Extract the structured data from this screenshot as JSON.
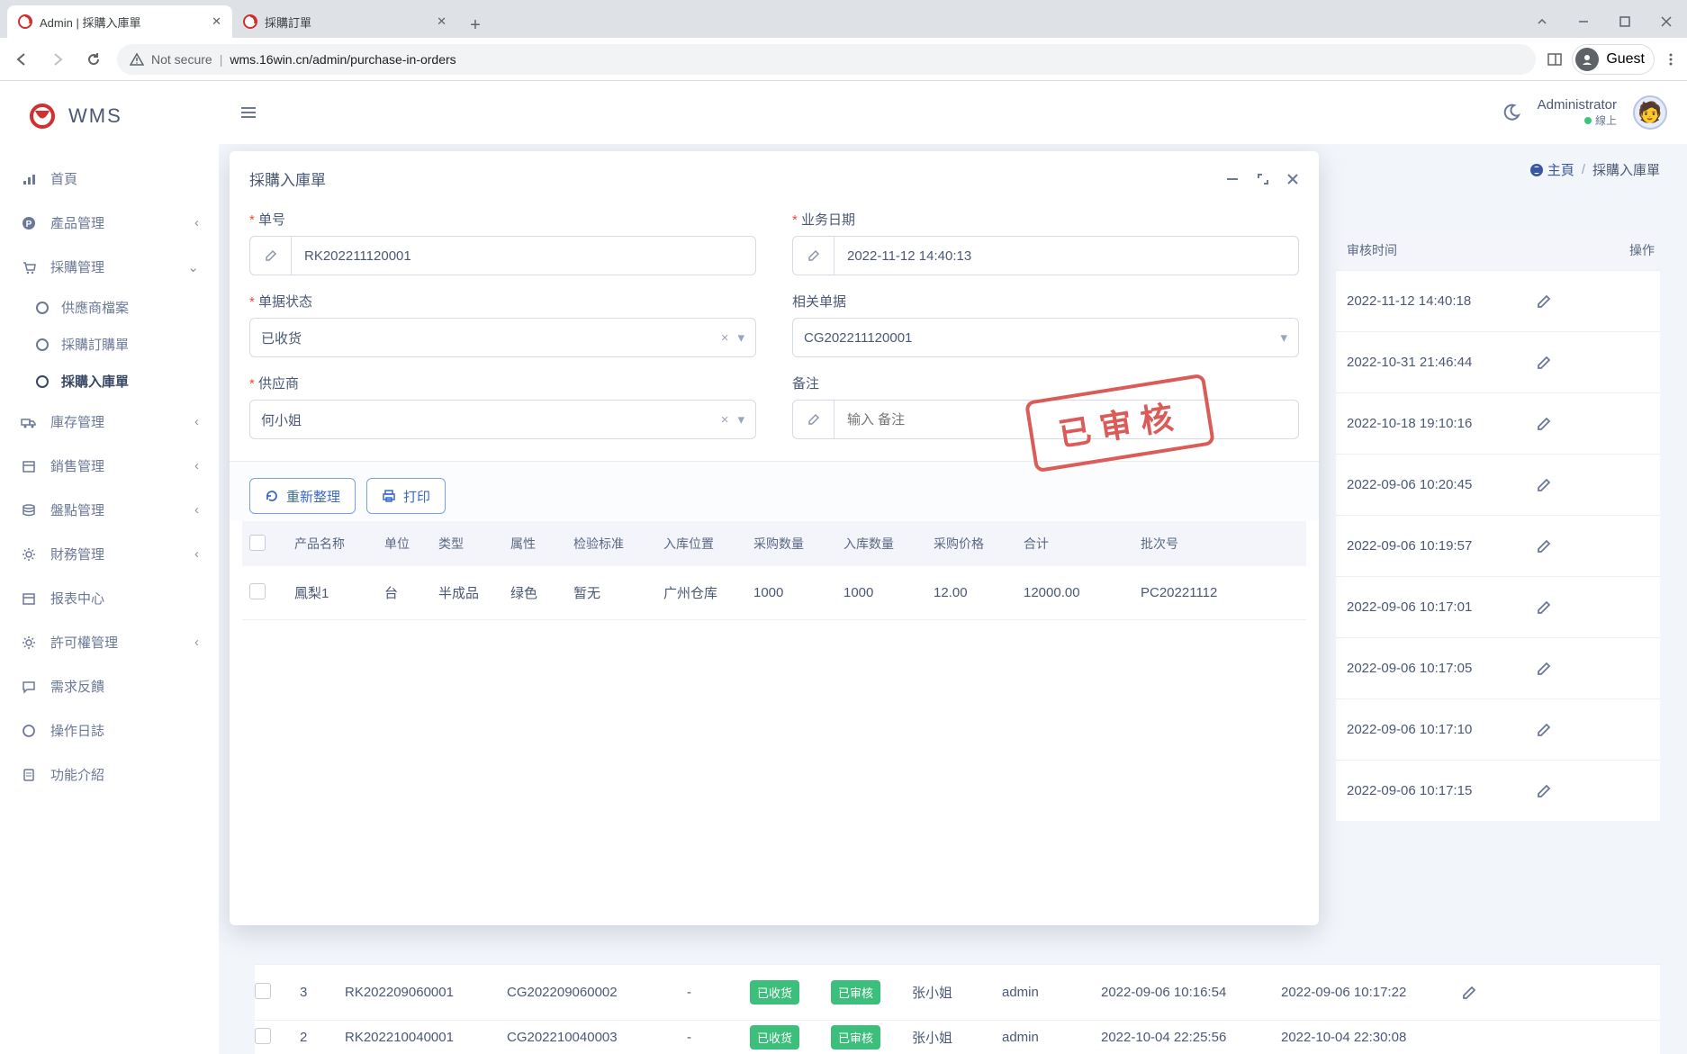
{
  "browser": {
    "tabs": [
      {
        "title": "Admin | 採購入庫單",
        "active": true
      },
      {
        "title": "採購訂單",
        "active": false
      }
    ],
    "url_prefix": "Not secure",
    "url": "wms.16win.cn/admin/purchase-in-orders",
    "guest": "Guest"
  },
  "logo": "WMS",
  "sidebar": {
    "items": [
      {
        "icon": "bars",
        "label": "首頁"
      },
      {
        "icon": "p-circle",
        "label": "產品管理",
        "expandable": true
      },
      {
        "icon": "cart",
        "label": "採購管理",
        "expandable": true,
        "open": true,
        "children": [
          {
            "label": "供應商檔案"
          },
          {
            "label": "採購訂購單"
          },
          {
            "label": "採購入庫單",
            "active": true
          }
        ]
      },
      {
        "icon": "truck",
        "label": "庫存管理",
        "expandable": true
      },
      {
        "icon": "calendar",
        "label": "銷售管理",
        "expandable": true
      },
      {
        "icon": "stack",
        "label": "盤點管理",
        "expandable": true
      },
      {
        "icon": "gear",
        "label": "財務管理",
        "expandable": true
      },
      {
        "icon": "calendar2",
        "label": "报表中心"
      },
      {
        "icon": "gear",
        "label": "許可權管理",
        "expandable": true
      },
      {
        "icon": "chat",
        "label": "需求反饋"
      },
      {
        "icon": "circle",
        "label": "操作日誌"
      },
      {
        "icon": "doc",
        "label": "功能介紹"
      }
    ]
  },
  "topbar": {
    "username": "Administrator",
    "status": "線上"
  },
  "breadcrumb": {
    "home": "主頁",
    "current": "採購入庫單"
  },
  "modal": {
    "title": "採購入庫單",
    "fields": {
      "order_no_label": "单号",
      "order_no": "RK202211120001",
      "biz_date_label": "业务日期",
      "biz_date": "2022-11-12 14:40:13",
      "status_label": "单据状态",
      "status": "已收货",
      "related_label": "相关单据",
      "related": "CG202211120001",
      "supplier_label": "供应商",
      "supplier": "何小姐",
      "remark_label": "备注",
      "remark_placeholder": "输入 备注"
    },
    "stamp": "已审核",
    "buttons": {
      "refresh": "重新整理",
      "print": "打印"
    },
    "table": {
      "headers": [
        "",
        "产品名称",
        "单位",
        "类型",
        "属性",
        "检验标准",
        "入库位置",
        "采购数量",
        "入库数量",
        "采购价格",
        "合计",
        "批次号"
      ],
      "rows": [
        {
          "name": "鳳梨1",
          "unit": "台",
          "type": "半成品",
          "attr": "绿色",
          "std": "暂无",
          "loc": "广州仓库",
          "qty_buy": "1000",
          "qty_in": "1000",
          "price": "12.00",
          "total": "12000.00",
          "batch": "PC20221112"
        }
      ]
    }
  },
  "bg_table": {
    "head1": "审核时间",
    "head2": "操作",
    "rows": [
      "2022-11-12 14:40:18",
      "2022-10-31 21:46:44",
      "2022-10-18 19:10:16",
      "2022-09-06 10:20:45",
      "2022-09-06 10:19:57",
      "2022-09-06 10:17:01",
      "2022-09-06 10:17:05",
      "2022-09-06 10:17:10",
      "2022-09-06 10:17:15"
    ]
  },
  "bottom_rows": [
    {
      "idx": "3",
      "no": "RK202209060001",
      "rel": "CG202209060002",
      "dash": "-",
      "tag1": "已收货",
      "tag2": "已审核",
      "who": "张小姐",
      "user": "admin",
      "t1": "2022-09-06 10:16:54",
      "t2": "2022-09-06 10:17:22"
    },
    {
      "idx": "2",
      "no": "RK202210040001",
      "rel": "CG202210040003",
      "dash": "-",
      "tag1": "已收货",
      "tag2": "已审核",
      "who": "张小姐",
      "user": "admin",
      "t1": "2022-10-04 22:25:56",
      "t2": "2022-10-04 22:30:08"
    }
  ]
}
